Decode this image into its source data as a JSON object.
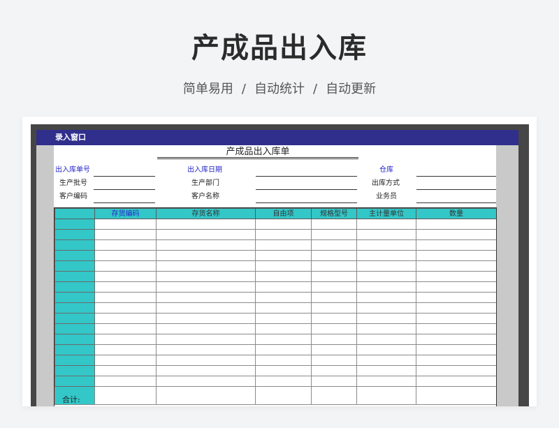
{
  "hero": {
    "title": "产成品出入库",
    "tagline": [
      "简单易用",
      "自动统计",
      "自动更新"
    ],
    "separator": "/"
  },
  "window": {
    "title": "录入窗口"
  },
  "form": {
    "title": "产成品出入库单",
    "fields": {
      "doc_no": "出入库单号",
      "doc_date": "出入库日期",
      "warehouse": "仓库",
      "batch_no": "生产批号",
      "department": "生产部门",
      "io_method": "出库方式",
      "customer_code": "客户编码",
      "customer_name": "客户名称",
      "salesperson": "业务员"
    }
  },
  "table": {
    "columns": [
      "存货编码",
      "存货名称",
      "自由项",
      "规格型号",
      "主计量单位",
      "数量"
    ],
    "total_label": "合计:"
  },
  "colors": {
    "title_bar": "#302f8c",
    "header_cyan": "#33c7c8",
    "label_blue": "#2525c8"
  }
}
